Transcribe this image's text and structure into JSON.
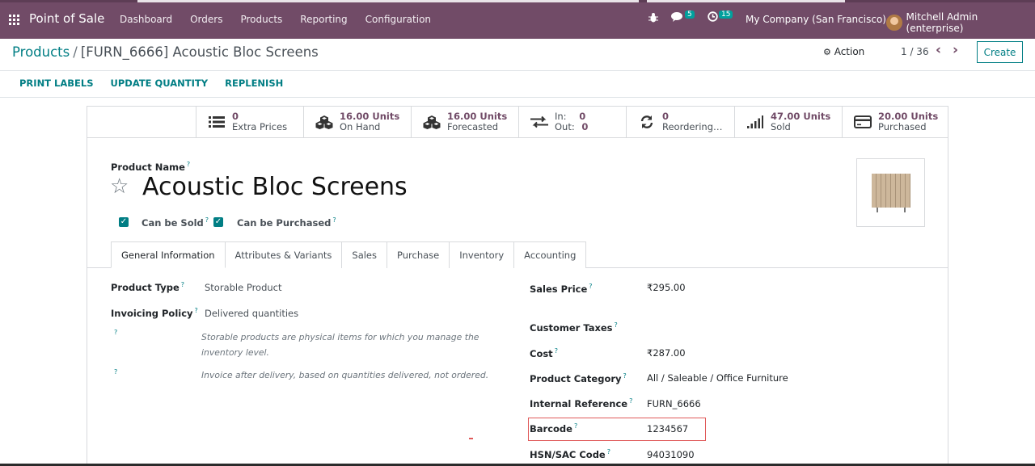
{
  "navbar": {
    "brand": "Point of Sale",
    "menu": [
      "Dashboard",
      "Orders",
      "Products",
      "Reporting",
      "Configuration"
    ],
    "messages_count": "5",
    "activities_count": "15",
    "company": "My Company (San Francisco)",
    "user": "Mitchell Admin (enterprise)"
  },
  "control": {
    "breadcrumb_parent": "Products",
    "breadcrumb_sep": "/",
    "breadcrumb_current": "[FURN_6666] Acoustic Bloc Screens",
    "action_label": "Action",
    "pager": "1 / 36",
    "create_label": "Create"
  },
  "header_buttons": [
    "PRINT LABELS",
    "UPDATE QUANTITY",
    "REPLENISH"
  ],
  "smart_buttons": [
    {
      "icon": "list-icon",
      "value": "0",
      "label": "Extra Prices"
    },
    {
      "icon": "cubes-icon",
      "value": "16.00 Units",
      "label": "On Hand"
    },
    {
      "icon": "cubes-icon",
      "value": "16.00 Units",
      "label": "Forecasted"
    },
    {
      "icon": "exchange-icon",
      "in_label": "In:",
      "in_value": "0",
      "out_label": "Out:",
      "out_value": "0"
    },
    {
      "icon": "refresh-icon",
      "value": "0",
      "label": "Reordering…"
    },
    {
      "icon": "signal-icon",
      "value": "47.00 Units",
      "label": "Sold"
    },
    {
      "icon": "credit-card-icon",
      "value": "20.00 Units",
      "label": "Purchased"
    }
  ],
  "product": {
    "name_label": "Product Name",
    "name": "Acoustic Bloc Screens",
    "can_be_sold_label": "Can be Sold",
    "can_be_purchased_label": "Can be Purchased",
    "can_be_sold": true,
    "can_be_purchased": true
  },
  "tabs": [
    "General Information",
    "Attributes & Variants",
    "Sales",
    "Purchase",
    "Inventory",
    "Accounting"
  ],
  "left_fields": {
    "product_type_label": "Product Type",
    "product_type": "Storable Product",
    "invoicing_policy_label": "Invoicing Policy",
    "invoicing_policy": "Delivered quantities",
    "note1": "Storable products are physical items for which you manage the inventory level.",
    "note2": "Invoice after delivery, based on quantities delivered, not ordered."
  },
  "right_fields": {
    "sales_price_label": "Sales Price",
    "sales_price": "₹295.00",
    "customer_taxes_label": "Customer Taxes",
    "customer_taxes": "",
    "cost_label": "Cost",
    "cost": "₹287.00",
    "product_category_label": "Product Category",
    "product_category": "All / Saleable / Office Furniture",
    "internal_reference_label": "Internal Reference",
    "internal_reference": "FURN_6666",
    "barcode_label": "Barcode",
    "barcode": "1234567",
    "hsn_label": "HSN/SAC Code",
    "hsn": "94031090"
  },
  "tooltip_marker": "?"
}
